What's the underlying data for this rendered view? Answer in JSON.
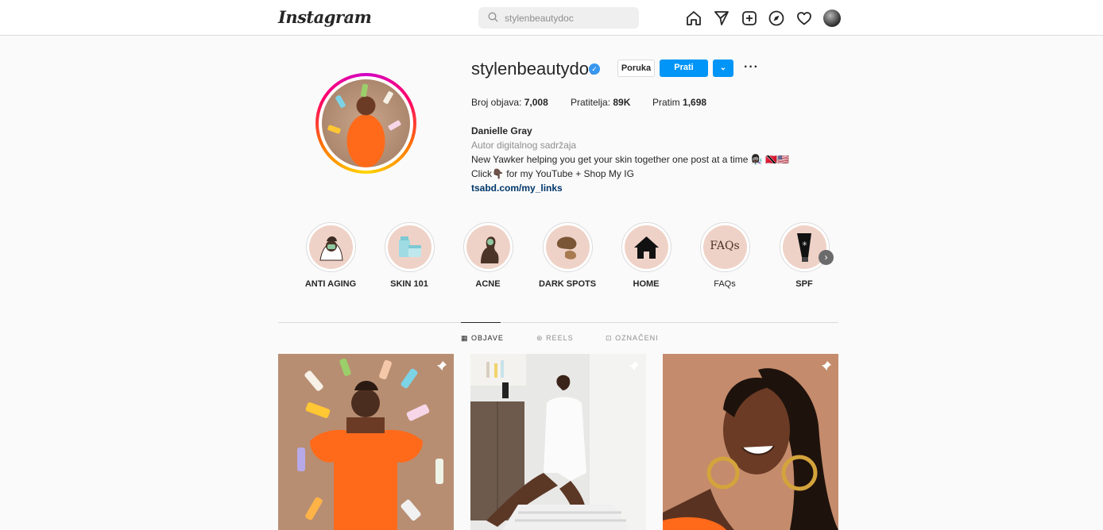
{
  "navbar": {
    "logo": "Instagram",
    "search_placeholder": "stylenbeautydoc",
    "icons": [
      "home-icon",
      "direct-icon",
      "new-post-icon",
      "explore-icon",
      "activity-icon"
    ]
  },
  "profile": {
    "username": "stylenbeautydoc",
    "message_label": "Poruka",
    "follow_label": "Prati",
    "suggest_label": "⌄",
    "more_label": "···",
    "posts_label": "Broj objava:",
    "posts_count": "7,008",
    "followers_label": "Pratitelja:",
    "followers_count": "89K",
    "following_label": "Pratim",
    "following_count": "1,698",
    "full_name": "Danielle Gray",
    "category": "Autor digitalnog sadržaja",
    "bio_line1": "New Yawker helping you get your skin together one post at a time 👩🏿‍🔬 🇹🇹🇺🇸",
    "bio_line2": "Click👇🏿 for my YouTube + Shop My IG",
    "link": "tsabd.com/my_links"
  },
  "highlights": [
    {
      "label": "ANTI AGING"
    },
    {
      "label": "SKIN 101"
    },
    {
      "label": "ACNE"
    },
    {
      "label": "DARK SPOTS"
    },
    {
      "label": "HOME"
    },
    {
      "label": "FAQs",
      "cover_text": "FAQs"
    },
    {
      "label": "SPF"
    }
  ],
  "tabs": [
    {
      "label": "OBJAVE"
    },
    {
      "label": "REELS"
    },
    {
      "label": "OZNAČENI"
    }
  ],
  "colors": {
    "accent": "#0095f6",
    "verified": "#3897f0",
    "link": "#00376b",
    "highlight_bg": "#efd2c7"
  }
}
